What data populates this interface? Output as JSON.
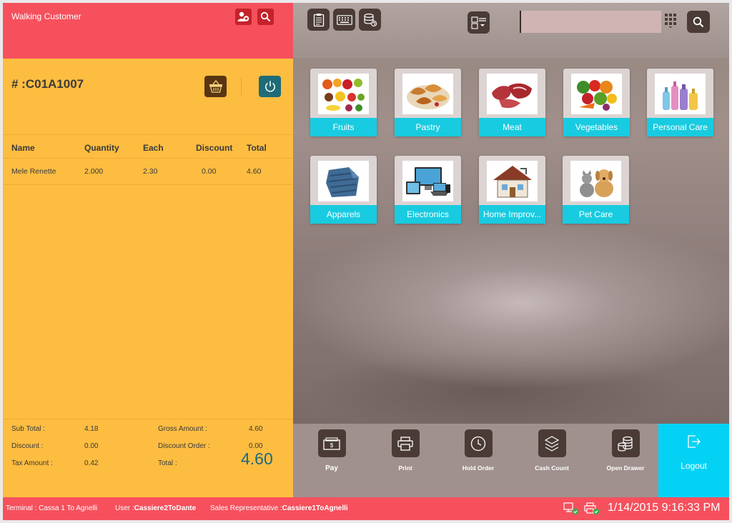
{
  "customer": {
    "name": "Walking Customer"
  },
  "order": {
    "number": "# :C01A1007"
  },
  "table": {
    "headers": [
      "Name",
      "Quantity",
      "Each",
      "Discount",
      "Total"
    ],
    "rows": [
      {
        "name": "Mele Renette",
        "quantity": "2.000",
        "each": "2.30",
        "discount": "0.00",
        "total": "4.60"
      }
    ]
  },
  "summary": {
    "sub_total_label": "Sub Total :",
    "sub_total": "4.18",
    "discount_label": "Discount :",
    "discount": "0.00",
    "tax_label": "Tax Amount :",
    "tax": "0.42",
    "gross_label": "Gross Amount :",
    "gross": "4.60",
    "discount_order_label": "Discount Order :",
    "discount_order": "0.00",
    "total_label": "Total :",
    "total": "4.60"
  },
  "search": {
    "value": ""
  },
  "categories": [
    {
      "label": "Fruits",
      "icon": "fruits-image"
    },
    {
      "label": "Pastry",
      "icon": "pastry-image"
    },
    {
      "label": "Meat",
      "icon": "meat-image"
    },
    {
      "label": "Vegetables",
      "icon": "vegetables-image"
    },
    {
      "label": "Personal Care",
      "icon": "personal-care-image"
    },
    {
      "label": "Apparels",
      "icon": "apparels-image"
    },
    {
      "label": "Electronics",
      "icon": "electronics-image"
    },
    {
      "label": "Home Improv...",
      "icon": "home-improvement-image"
    },
    {
      "label": "Pet Care",
      "icon": "pet-care-image"
    }
  ],
  "actions": {
    "pay": "Pay",
    "print": "Print",
    "hold_order": "Hold Order",
    "cash_count": "Cash Count",
    "open_drawer": "Open Drawer",
    "logout": "Logout"
  },
  "status": {
    "terminal_label": "Terminal : ",
    "terminal": "Cassa 1 To Agnelli",
    "user_label": "User :",
    "user": "Cassiere2ToDante",
    "sales_rep_label": "Sales Representative :",
    "sales_rep": "Cassiere1ToAgnelli",
    "datetime": "1/14/2015 9:16:33 PM"
  },
  "colors": {
    "header_red": "#f6505d",
    "order_yellow": "#fdbd41",
    "tile_cyan": "#19cbe0",
    "logout_cyan": "#03d2f5",
    "dark_button": "#4a3b37"
  }
}
